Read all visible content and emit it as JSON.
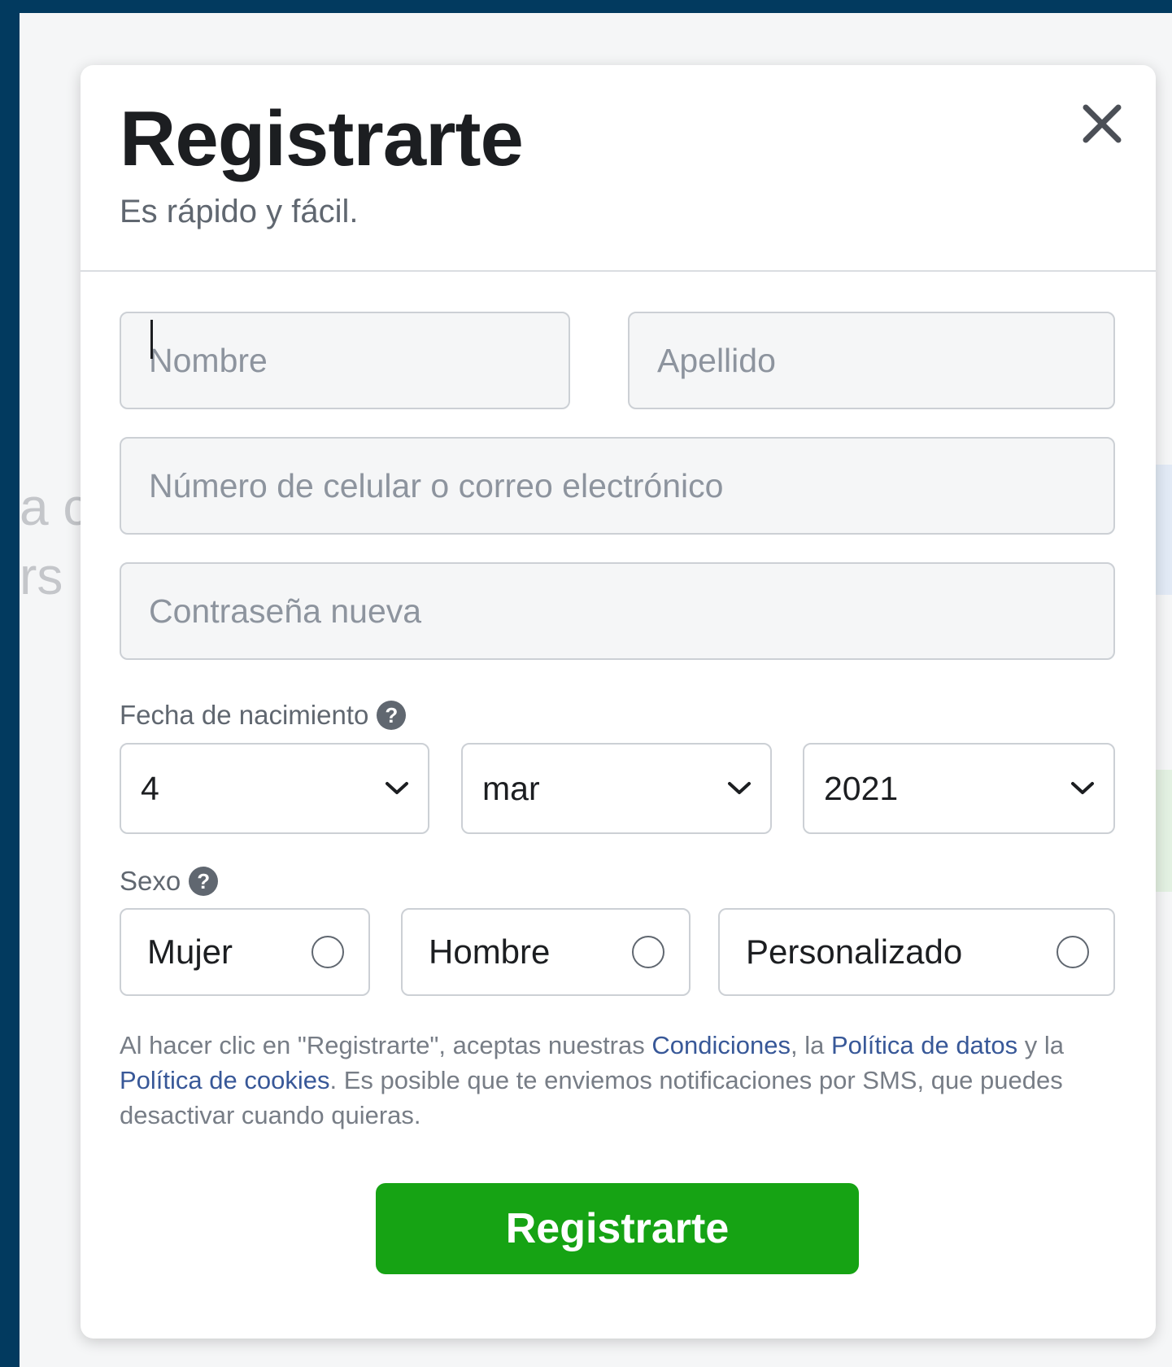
{
  "modal": {
    "title": "Registrarte",
    "subtitle": "Es rápido y fácil.",
    "close_icon": "close-icon"
  },
  "form": {
    "first_name": {
      "placeholder": "Nombre",
      "value": ""
    },
    "last_name": {
      "placeholder": "Apellido",
      "value": ""
    },
    "contact": {
      "placeholder": "Número de celular o correo electrónico",
      "value": ""
    },
    "password": {
      "placeholder": "Contraseña nueva",
      "value": ""
    }
  },
  "birthdate": {
    "label": "Fecha de nacimiento",
    "help_icon": "help-icon",
    "day": "4",
    "month": "mar",
    "year": "2021"
  },
  "gender": {
    "label": "Sexo",
    "help_icon": "help-icon",
    "options": [
      "Mujer",
      "Hombre",
      "Personalizado"
    ]
  },
  "terms": {
    "prefix": "Al hacer clic en \"Registrarte\", aceptas nuestras ",
    "link_conditions": "Condiciones",
    "sep1": ", la ",
    "link_data_policy": "Política de datos",
    "sep2": " y la ",
    "link_cookie_policy": "Política de cookies",
    "suffix": ". Es posible que te enviemos notificaciones por SMS, que puedes desactivar cuando quieras."
  },
  "submit_label": "Registrarte",
  "background": {
    "fragment_1": "a c",
    "fragment_2": "rs"
  },
  "colors": {
    "page_border": "#023a5f",
    "submit": "#16a314",
    "link": "#385898"
  }
}
